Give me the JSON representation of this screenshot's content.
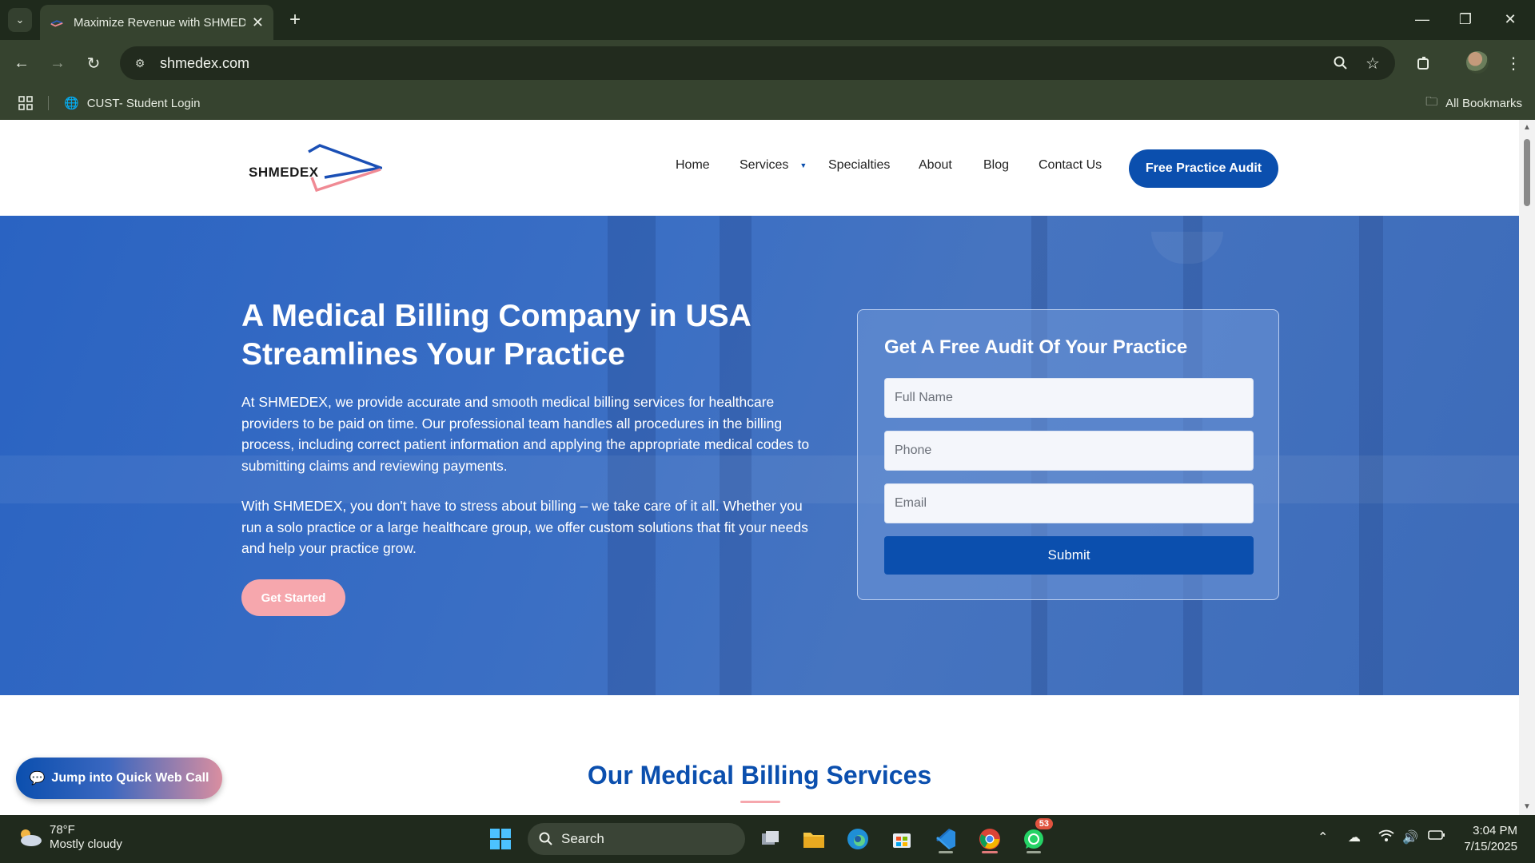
{
  "browser": {
    "tab_title": "Maximize Revenue with SHMEDEX",
    "url": "shmedex.com",
    "bookmark": "CUST- Student Login",
    "all_bookmarks": "All Bookmarks"
  },
  "site": {
    "logo_text": "SHMEDEX",
    "nav": [
      "Home",
      "Services",
      "Specialties",
      "About",
      "Blog",
      "Contact Us"
    ],
    "cta": "Free Practice Audit"
  },
  "hero": {
    "title": "A Medical Billing Company in USA Streamlines Your Practice",
    "p1": "At SHMEDEX, we provide accurate and smooth medical billing services for healthcare providers to be paid on time. Our professional team handles all procedures in the billing process, including correct patient information and applying the appropriate medical codes to submitting claims and reviewing payments.",
    "p2": "With SHMEDEX, you don't have to stress about billing – we take care of it all. Whether you run a solo practice or a large healthcare group, we offer custom solutions that fit your needs and help your practice grow.",
    "button": "Get Started"
  },
  "audit_form": {
    "title": "Get A Free Audit Of Your Practice",
    "name_placeholder": "Full Name",
    "phone_placeholder": "Phone",
    "email_placeholder": "Email",
    "submit": "Submit"
  },
  "services": {
    "title": "Our Medical Billing Services"
  },
  "floating": {
    "webcall": "Jump into Quick Web Call"
  },
  "taskbar": {
    "temp": "78°F",
    "condition": "Mostly cloudy",
    "search": "Search",
    "whatsapp_badge": "53",
    "time": "3:04 PM",
    "date": "7/15/2025"
  },
  "colors": {
    "brand_blue": "#0b4fae",
    "accent_pink": "#f6a7ad"
  }
}
